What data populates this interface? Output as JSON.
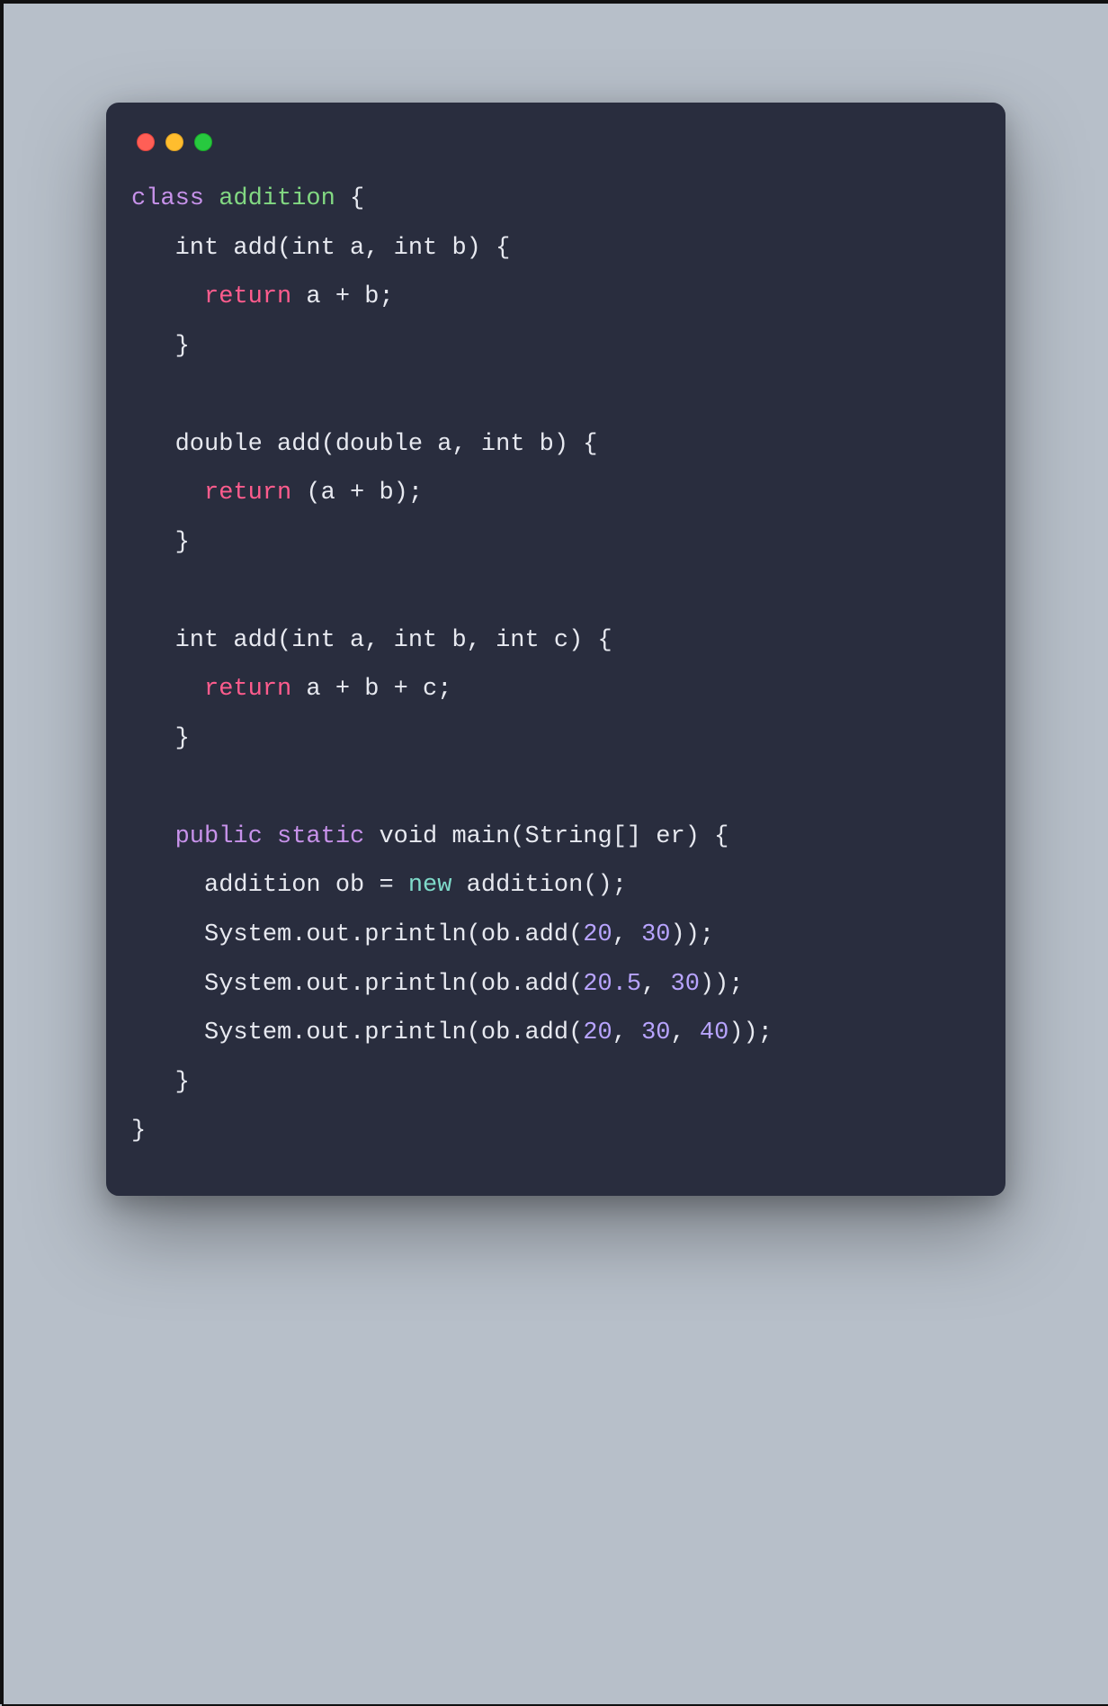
{
  "traffic_lights": [
    "red",
    "yellow",
    "green"
  ],
  "syntax_colors": {
    "keyword": "#c792ea",
    "return": "#ff5c8d",
    "new": "#7fdbca",
    "class_name": "#82d882",
    "number": "#b8a4ff",
    "text": "#e7e9f0",
    "background": "#292d3e"
  },
  "code": {
    "l01_class": "class",
    "l01_name": "addition",
    "l01_rest": " {",
    "l02": "   int add(int a, int b) {",
    "l03_ret": "return",
    "l03_rest": " a + b;",
    "l04": "   }",
    "l05": "",
    "l06": "   double add(double a, int b) {",
    "l07_ret": "return",
    "l07_rest": " (a + b);",
    "l08": "   }",
    "l09": "",
    "l10": "   int add(int a, int b, int c) {",
    "l11_ret": "return",
    "l11_rest": " a + b + c;",
    "l12": "   }",
    "l13": "",
    "l14_pub": "public",
    "l14_static": "static",
    "l14_rest": " void main(String[] er) {",
    "l15_a": "     addition ob = ",
    "l15_new": "new",
    "l15_b": " addition();",
    "l16_a": "     System.out.println(ob.add(",
    "l16_n1": "20",
    "l16_mid": ", ",
    "l16_n2": "30",
    "l16_end": "));",
    "l17_a": "     System.out.println(ob.add(",
    "l17_n1": "20.5",
    "l17_mid": ", ",
    "l17_n2": "30",
    "l17_end": "));",
    "l18_a": "     System.out.println(ob.add(",
    "l18_n1": "20",
    "l18_m1": ", ",
    "l18_n2": "30",
    "l18_m2": ", ",
    "l18_n3": "40",
    "l18_end": "));",
    "l19": "   }",
    "l20": "}"
  }
}
